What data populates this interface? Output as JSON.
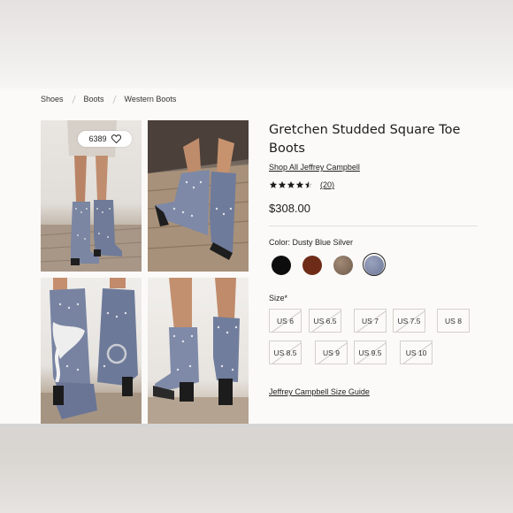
{
  "breadcrumb": [
    "Shoes",
    "Boots",
    "Western Boots"
  ],
  "gallery": {
    "likes_count": "6389",
    "images": [
      "boots-worn-front",
      "boots-side-wooden-floor",
      "boots-tied-scarf",
      "boots-worn-back"
    ]
  },
  "product": {
    "title": "Gretchen Studded Square Toe Boots",
    "brand_link": "Shop All Jeffrey Campbell",
    "rating": 4.5,
    "review_count": "(20)",
    "price": "$308.00"
  },
  "color": {
    "label": "Color: Dusty Blue Silver",
    "swatches": [
      {
        "name": "black",
        "hex": "#0d0d0d"
      },
      {
        "name": "brown",
        "hex": "#6e2c18"
      },
      {
        "name": "taupe",
        "hex": "#8a7462"
      },
      {
        "name": "dusty-blue",
        "hex": "#8791ad",
        "selected": true
      }
    ]
  },
  "sizes": {
    "label": "Size*",
    "options": [
      {
        "label": "US 6",
        "available": false
      },
      {
        "label": "US 6.5",
        "available": false
      },
      {
        "label": "US 7",
        "available": false
      },
      {
        "label": "US 7.5",
        "available": false
      },
      {
        "label": "US 8",
        "available": true
      },
      {
        "label": "US 8.5",
        "available": false
      },
      {
        "label": "US 9",
        "available": false
      },
      {
        "label": "US 9.5",
        "available": false
      },
      {
        "label": "US 10",
        "available": false
      }
    ]
  },
  "size_guide_link": "Jeffrey Campbell Size Guide"
}
